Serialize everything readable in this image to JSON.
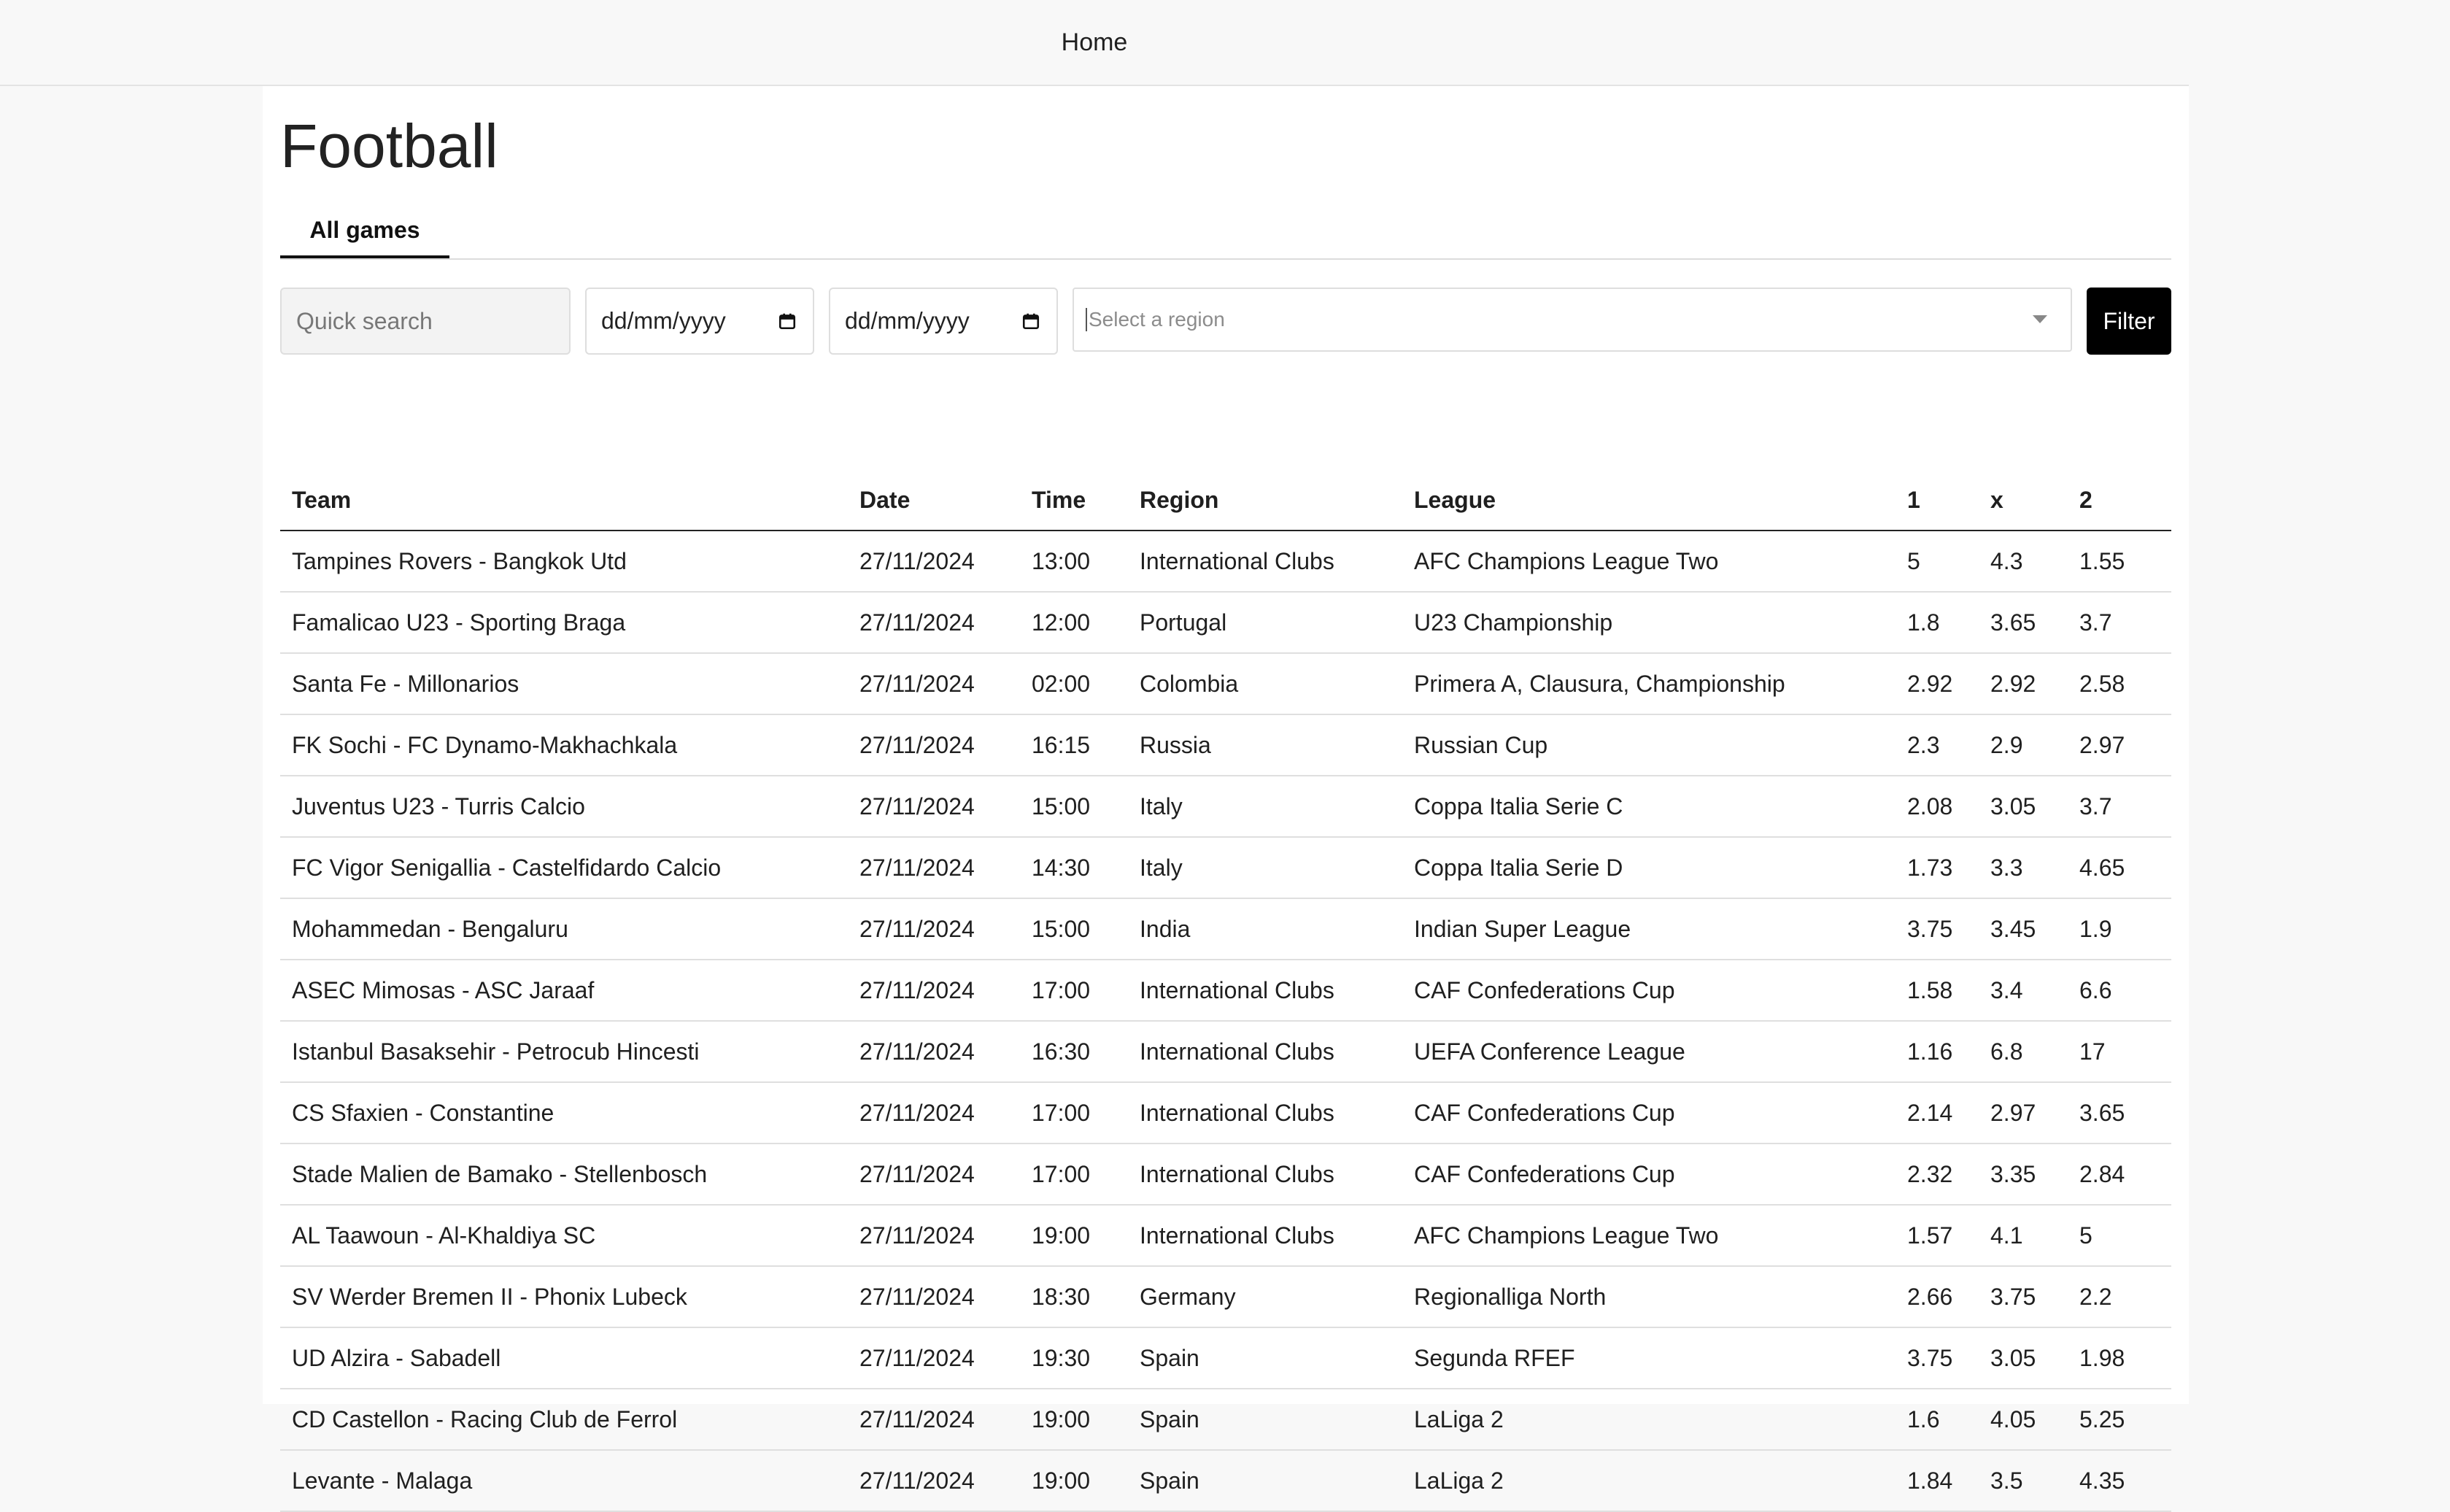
{
  "nav": {
    "home_label": "Home"
  },
  "page": {
    "title": "Football"
  },
  "tabs": [
    {
      "label": "All games",
      "active": true
    }
  ],
  "filters": {
    "search_placeholder": "Quick search",
    "date_from_placeholder": "dd/mm/yyyy",
    "date_to_placeholder": "dd/mm/yyyy",
    "region_placeholder": "Select a region",
    "filter_button": "Filter"
  },
  "table": {
    "headers": [
      "Team",
      "Date",
      "Time",
      "Region",
      "League",
      "1",
      "x",
      "2"
    ],
    "rows": [
      [
        "Tampines Rovers - Bangkok Utd",
        "27/11/2024",
        "13:00",
        "International Clubs",
        "AFC Champions League Two",
        "5",
        "4.3",
        "1.55"
      ],
      [
        "Famalicao U23 - Sporting Braga",
        "27/11/2024",
        "12:00",
        "Portugal",
        "U23 Championship",
        "1.8",
        "3.65",
        "3.7"
      ],
      [
        "Santa Fe - Millonarios",
        "27/11/2024",
        "02:00",
        "Colombia",
        "Primera A, Clausura, Championship",
        "2.92",
        "2.92",
        "2.58"
      ],
      [
        "FK Sochi - FC Dynamo-Makhachkala",
        "27/11/2024",
        "16:15",
        "Russia",
        "Russian Cup",
        "2.3",
        "2.9",
        "2.97"
      ],
      [
        "Juventus U23 - Turris Calcio",
        "27/11/2024",
        "15:00",
        "Italy",
        "Coppa Italia Serie C",
        "2.08",
        "3.05",
        "3.7"
      ],
      [
        "FC Vigor Senigallia - Castelfidardo Calcio",
        "27/11/2024",
        "14:30",
        "Italy",
        "Coppa Italia Serie D",
        "1.73",
        "3.3",
        "4.65"
      ],
      [
        "Mohammedan - Bengaluru",
        "27/11/2024",
        "15:00",
        "India",
        "Indian Super League",
        "3.75",
        "3.45",
        "1.9"
      ],
      [
        "ASEC Mimosas - ASC Jaraaf",
        "27/11/2024",
        "17:00",
        "International Clubs",
        "CAF Confederations Cup",
        "1.58",
        "3.4",
        "6.6"
      ],
      [
        "Istanbul Basaksehir - Petrocub Hincesti",
        "27/11/2024",
        "16:30",
        "International Clubs",
        "UEFA Conference League",
        "1.16",
        "6.8",
        "17"
      ],
      [
        "CS Sfaxien - Constantine",
        "27/11/2024",
        "17:00",
        "International Clubs",
        "CAF Confederations Cup",
        "2.14",
        "2.97",
        "3.65"
      ],
      [
        "Stade Malien de Bamako - Stellenbosch",
        "27/11/2024",
        "17:00",
        "International Clubs",
        "CAF Confederations Cup",
        "2.32",
        "3.35",
        "2.84"
      ],
      [
        "AL Taawoun - Al-Khaldiya SC",
        "27/11/2024",
        "19:00",
        "International Clubs",
        "AFC Champions League Two",
        "1.57",
        "4.1",
        "5"
      ],
      [
        "SV Werder Bremen II - Phonix Lubeck",
        "27/11/2024",
        "18:30",
        "Germany",
        "Regionalliga North",
        "2.66",
        "3.75",
        "2.2"
      ],
      [
        "UD Alzira - Sabadell",
        "27/11/2024",
        "19:30",
        "Spain",
        "Segunda RFEF",
        "3.75",
        "3.05",
        "1.98"
      ],
      [
        "CD Castellon - Racing Club de Ferrol",
        "27/11/2024",
        "19:00",
        "Spain",
        "LaLiga 2",
        "1.6",
        "4.05",
        "5.25"
      ],
      [
        "Levante - Malaga",
        "27/11/2024",
        "19:00",
        "Spain",
        "LaLiga 2",
        "1.84",
        "3.5",
        "4.35"
      ]
    ]
  }
}
